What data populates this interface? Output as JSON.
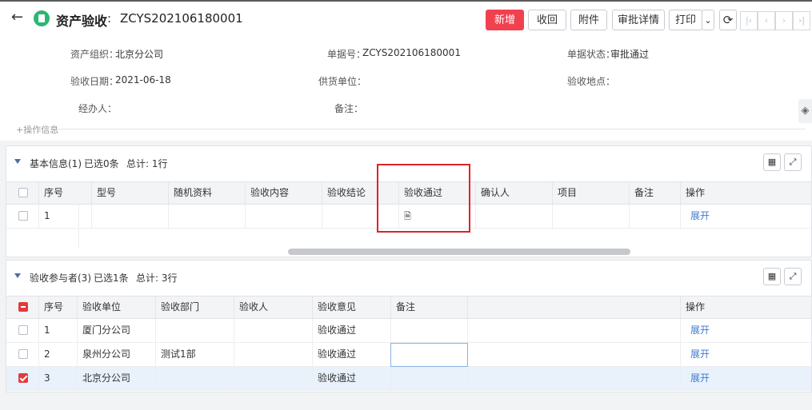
{
  "header": {
    "title": "资产验收",
    "colon": ":",
    "code": "ZCYS202106180001",
    "buttons": {
      "new": "新增",
      "recall": "收回",
      "attach": "附件",
      "approval_detail": "审批详情",
      "print": "打印",
      "print_dropdown": "⌄",
      "refresh": "⟳"
    },
    "nav": {
      "first": "|‹",
      "prev": "‹",
      "next": "›",
      "last": "›|"
    }
  },
  "form": {
    "fields": [
      {
        "label": "资产组织：",
        "value": "北京分公司"
      },
      {
        "label": "单据号：",
        "value": "ZCYS202106180001"
      },
      {
        "label": "单据状态：",
        "value": "审批通过"
      },
      {
        "label": "验收日期：",
        "value": "2021-06-18"
      },
      {
        "label": "供货单位：",
        "value": ""
      },
      {
        "label": "验收地点：",
        "value": ""
      },
      {
        "label": "经办人：",
        "value": ""
      },
      {
        "label": "备注：",
        "value": ""
      }
    ],
    "ops": "+操作信息"
  },
  "basic": {
    "title": "基本信息(1)",
    "selected": "已选0条",
    "total": "总计: 1行",
    "columns": [
      "序号",
      "型号",
      "随机资料",
      "验收内容",
      "验收结论",
      "验收通过",
      "确认人",
      "项目",
      "备注",
      "操作"
    ],
    "rows": [
      {
        "seq": "1",
        "pass_icon": "document-stamp-icon",
        "pass_glyph": "🗎",
        "action": "展开"
      }
    ]
  },
  "participants": {
    "title": "验收参与者(3)",
    "selected": "已选1条",
    "total": "总计: 3行",
    "columns": [
      "序号",
      "验收单位",
      "验收部门",
      "验收人",
      "验收意见",
      "备注",
      "操作"
    ],
    "rows": [
      {
        "seq": "1",
        "unit": "厦门分公司",
        "dept": "",
        "person": "",
        "opinion": "验收通过",
        "remark": "",
        "action": "展开",
        "checked": false
      },
      {
        "seq": "2",
        "unit": "泉州分公司",
        "dept": "测试1部",
        "person": "",
        "opinion": "验收通过",
        "remark": "",
        "action": "展开",
        "checked": false
      },
      {
        "seq": "3",
        "unit": "北京分公司",
        "dept": "",
        "person": "",
        "opinion": "验收通过",
        "remark": "",
        "action": "展开",
        "checked": true
      }
    ]
  },
  "icons": {
    "back": "←",
    "grid": "▦",
    "expand": "⤢",
    "layers": "◈"
  },
  "colors": {
    "primary_button": "#f1414f",
    "link": "#3f7ad1",
    "status_icon": "#2bb673",
    "highlight_box": "#e0222b"
  }
}
